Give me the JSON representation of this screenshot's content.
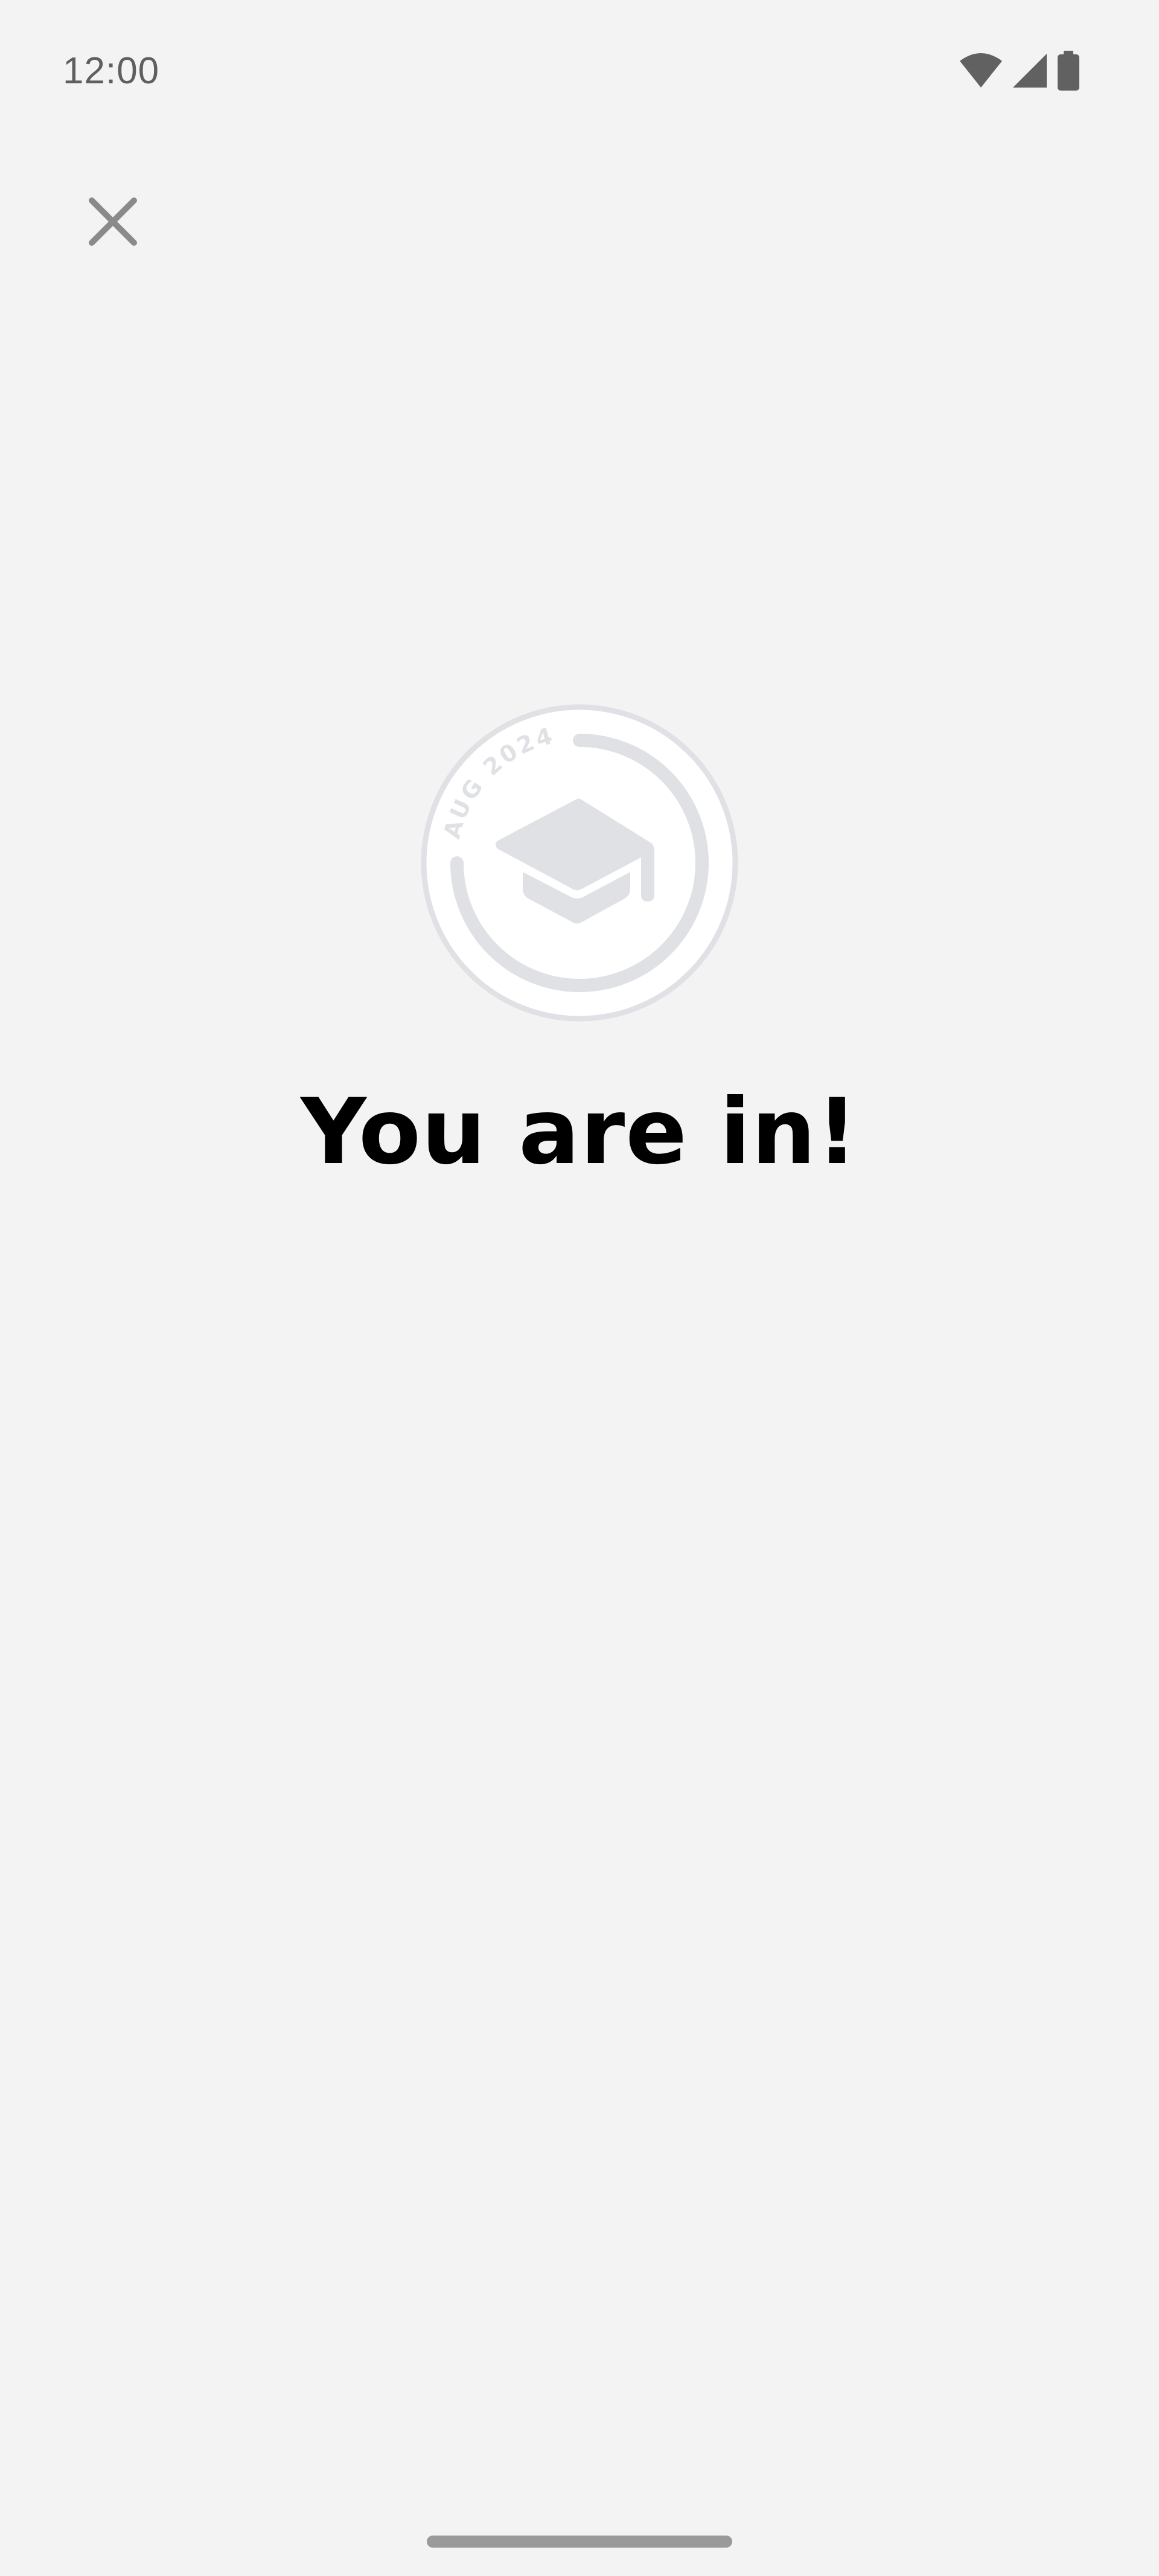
{
  "status_bar": {
    "time": "12:00",
    "icons": [
      "wifi-icon",
      "cellular-signal-icon",
      "battery-icon"
    ],
    "icon_color": "#616161"
  },
  "close_button": {
    "icon": "close-icon",
    "color": "#8a8a8a"
  },
  "badge": {
    "icon": "graduation-cap-icon",
    "ring_text": "AUG 2024",
    "color": "#dfe1e5"
  },
  "headline": "You are in!",
  "background_color": "#f3f3f3"
}
